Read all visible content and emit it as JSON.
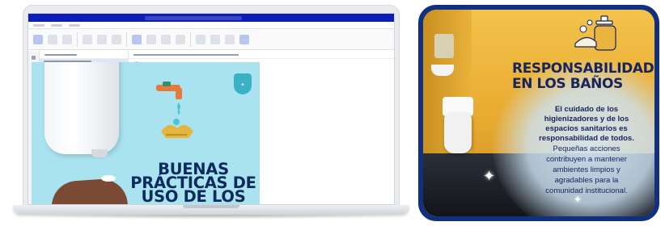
{
  "email_preview": {
    "headline_lines": [
      "BUENAS",
      "PRÁCTICAS DE",
      "USO DE LOS"
    ],
    "colors": {
      "titlebar": "#0f1db8",
      "image_background": "#a9e3ef",
      "headline": "#0e2a5c"
    }
  },
  "poster": {
    "title_lines": [
      "RESPONSABILIDAD",
      "EN LOS BAÑOS"
    ],
    "body_bold_lines": [
      "El cuidado de los",
      "higienizadores y de los",
      "espacios sanitarios es",
      "responsabilidad de todos."
    ],
    "body_regular_lines": [
      "Pequeñas acciones",
      "contribuyen a mantener",
      "ambientes limpios y",
      "agradables para la",
      "comunidad institucional."
    ],
    "colors": {
      "frame": "#123080",
      "title": "#17245e",
      "wall": "#e9b53e",
      "glow": "#d6e8f4"
    }
  },
  "icons": [
    "faucet-icon",
    "washing-hands-icon",
    "shield-badge-icon",
    "soap-dispenser-icon",
    "sparkle-icon"
  ]
}
